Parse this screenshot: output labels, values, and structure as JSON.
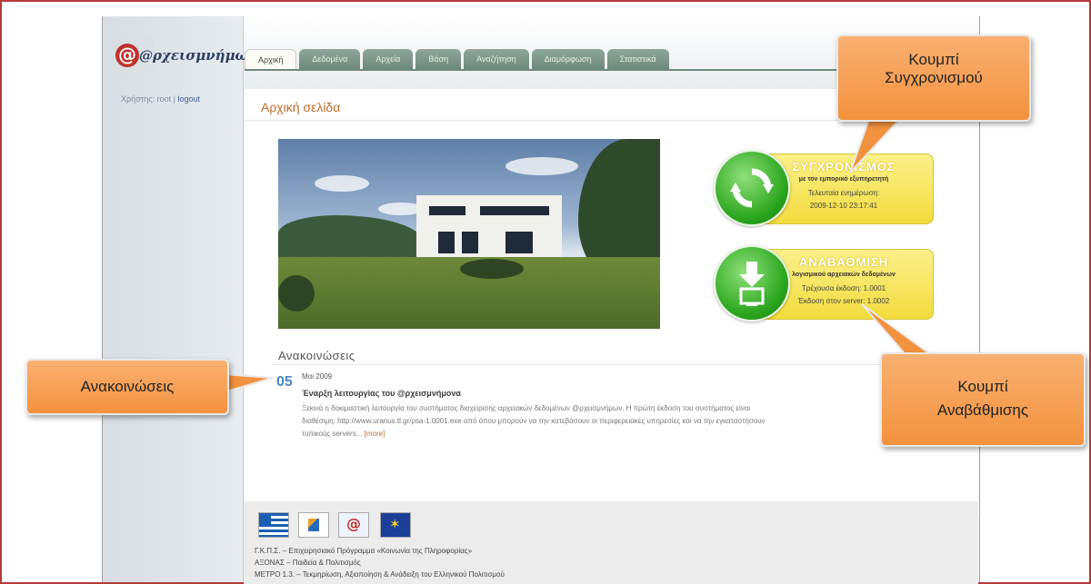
{
  "app": {
    "logo_text": "@ρχεισμνήμων",
    "user_label": "Χρήστης: root |",
    "logout_label": "logout"
  },
  "tabs": [
    {
      "label": "Αρχική",
      "active": true
    },
    {
      "label": "Δεδομένα",
      "active": false
    },
    {
      "label": "Αρχεία",
      "active": false
    },
    {
      "label": "Βάση",
      "active": false
    },
    {
      "label": "Αναζήτηση",
      "active": false
    },
    {
      "label": "Διαμόρφωση",
      "active": false
    },
    {
      "label": "Στατιστικά",
      "active": false
    }
  ],
  "main": {
    "page_title": "Αρχική σελίδα",
    "sync_button": {
      "title": "ΣΥΓΧΡΟΝΙΣΜΟΣ",
      "subtitle": "με τον εμπορικό εξυπηρετητή",
      "last_update_label": "Τελευταία ενημέρωση:",
      "last_update_value": "2009-12-10 23:17:41"
    },
    "update_button": {
      "title": "ΑΝΑΒΑΘΜΙΣΗ",
      "subtitle": "λογισμικού αρχειακών δεδομένων",
      "current_version": "Τρέχουσα έκδοση: 1.0001",
      "server_version": "Έκδοση στον server: 1.0002"
    },
    "announcements": {
      "title": "Ανακοινώσεις",
      "items": [
        {
          "day": "05",
          "month": "Μαι 2009",
          "headline": "Έναρξη λειτουργίας του @ρχεισμνήμονα",
          "body_line1": "Ξεκινά η δοκιμαστική λειτουργία του συστήματος διαχείρισης αρχειακών δεδομένων @ρχεισμνήμων. Η πρώτη έκδοση του συστήματος είναι",
          "body_line2": "διαθέσιμη: http://www.uranus.tl.gr/ρsa-1.0001.exe από όπου μπορούν να την κατεβάσουν οι περιφερειακές υπηρεσίες και να την εγκαταστήσουν",
          "body_line3": "τοπικούς servers...",
          "more_label": "[more]"
        }
      ]
    }
  },
  "footer": {
    "lines": [
      "Γ.Κ.Π.Σ. – Επιχειρησιακό Πρόγραμμα «Κοινωνία της Πληροφορίας»",
      "ΑΞΟΝΑΣ – Παιδεία & Πολιτισμός",
      "ΜΕΤΡΟ 1.3. – Τεκμηρίωση, Αξιοποίηση & Ανάδειξη του Ελληνικού Πολιτισμού"
    ]
  },
  "callouts": {
    "sync": [
      "Κουμπί",
      "Συγχρονισμού"
    ],
    "announcements": "Ανακοινώσεις",
    "update": [
      "Κουμπί",
      "Αναβάθμισης"
    ]
  },
  "colors": {
    "callout_orange": "#f3923e",
    "title_orange": "#c06b2b",
    "tab_green": "#6e8a7c",
    "button_yellow": "#f2dc3c",
    "button_green": "#2aa51d",
    "frame_red": "#b33a3a"
  }
}
